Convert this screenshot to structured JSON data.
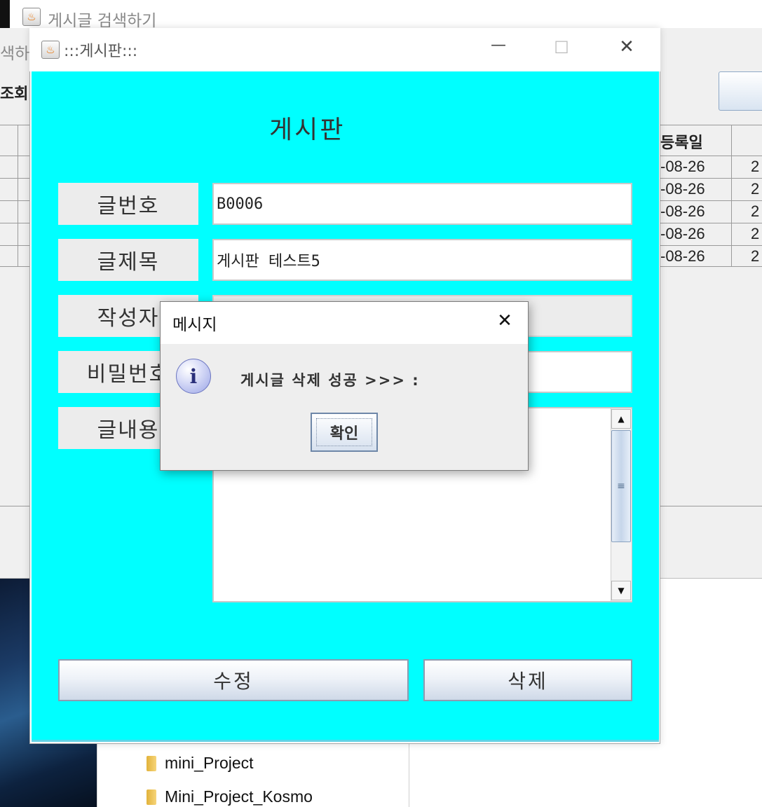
{
  "back_window": {
    "title": "게시글 검색하기",
    "title_partial": "색하",
    "toolbar_partial": "조회",
    "table_header_partial": "등록일",
    "rows": [
      {
        "date": "-08-26",
        "next": "2"
      },
      {
        "date": "-08-26",
        "next": "2"
      },
      {
        "date": "-08-26",
        "next": "2"
      },
      {
        "date": "-08-26",
        "next": "2"
      },
      {
        "date": "-08-26",
        "next": "2"
      }
    ]
  },
  "explorer": {
    "folders": [
      "mini_Project",
      "Mini_Project_Kosmo"
    ]
  },
  "frame": {
    "title": ":::게시판:::",
    "heading": "게시판",
    "labels": {
      "post_no": "글번호",
      "post_title": "글제목",
      "author": "작성자",
      "password": "비밀번호",
      "content": "글내용"
    },
    "values": {
      "post_no": "B0006",
      "post_title": "게시판 테스트5",
      "author": "",
      "password": "",
      "content": ""
    },
    "buttons": {
      "edit": "수정",
      "delete": "삭제"
    }
  },
  "dialog": {
    "title": "메시지",
    "message": "게시글 삭제 성공 >>> :",
    "ok": "확인",
    "icon": "info-icon"
  },
  "window_controls": {
    "minimize": "—",
    "maximize": "☐",
    "close": "✕"
  },
  "colors": {
    "content_background": "#00ffff",
    "dialog_background": "#eeeeee"
  }
}
